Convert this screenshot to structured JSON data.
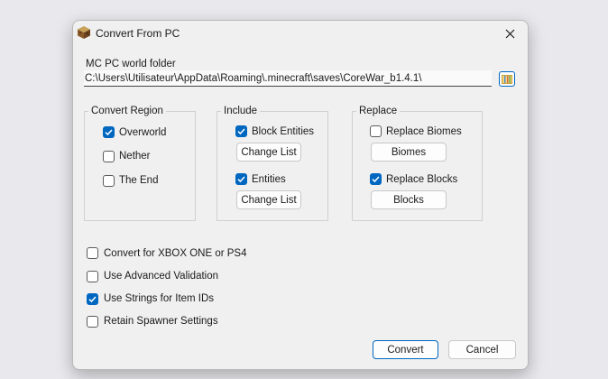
{
  "window": {
    "title": "Convert From PC",
    "app_icon": "minecraft-block-icon",
    "close_icon": "close-icon"
  },
  "world_folder": {
    "label": "MC PC world folder",
    "value": "C:\\Users\\Utilisateur\\AppData\\Roaming\\.minecraft\\saves\\CoreWar_b1.4.1\\",
    "browse_icon": "folder-browse-icon"
  },
  "convert_region": {
    "title": "Convert Region",
    "options": [
      {
        "label": "Overworld",
        "checked": true
      },
      {
        "label": "Nether",
        "checked": false
      },
      {
        "label": "The End",
        "checked": false
      }
    ]
  },
  "include": {
    "title": "Include",
    "block_entities": {
      "label": "Block Entities",
      "checked": true,
      "button": "Change List"
    },
    "entities": {
      "label": "Entities",
      "checked": true,
      "button": "Change List"
    }
  },
  "replace": {
    "title": "Replace",
    "biomes": {
      "label": "Replace Biomes",
      "checked": false,
      "button": "Biomes"
    },
    "blocks": {
      "label": "Replace Blocks",
      "checked": true,
      "button": "Blocks"
    }
  },
  "options": [
    {
      "label": "Convert for XBOX ONE or PS4",
      "checked": false
    },
    {
      "label": "Use Advanced Validation",
      "checked": false
    },
    {
      "label": "Use Strings for Item IDs",
      "checked": true
    },
    {
      "label": "Retain Spawner Settings",
      "checked": false
    }
  ],
  "buttons": {
    "convert": "Convert",
    "cancel": "Cancel"
  },
  "colors": {
    "accent": "#0067c0",
    "dialog_bg": "#f0f0f0",
    "backdrop": "#e9e9ed"
  }
}
